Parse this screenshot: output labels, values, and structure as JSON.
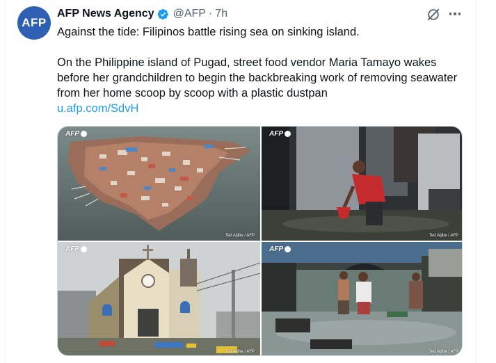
{
  "tweet": {
    "avatar_text": "AFP",
    "author_name": "AFP News Agency",
    "handle": "@AFP",
    "separator": "·",
    "time": "7h",
    "headline": "Against the tide: Filipinos battle rising sea on sinking island.",
    "body": "On the Philippine island of Pugad, street food vendor Maria Tamayo wakes before her grandchildren to begin the backbreaking work of removing seawater from her home scoop by scoop with a plastic dustpan",
    "link": "u.afp.com/SdvH"
  },
  "icons": {
    "verified": "verified-badge-icon",
    "grok": "grok-icon",
    "more": "more-icon"
  },
  "colors": {
    "verified": "#1d9bf0",
    "link": "#1d9bf0",
    "avatar_bg": "#2f5fb3"
  },
  "media": {
    "photos": [
      {
        "logo": "AFP",
        "credit": "Ted Aljibe / AFP"
      },
      {
        "logo": "AFP",
        "credit": "Ted Aljibe / AFP"
      },
      {
        "logo": "AFP",
        "credit": "Ted Aljibe / AFP"
      },
      {
        "logo": "AFP",
        "credit": "Ted Aljibe / AFP"
      }
    ]
  }
}
